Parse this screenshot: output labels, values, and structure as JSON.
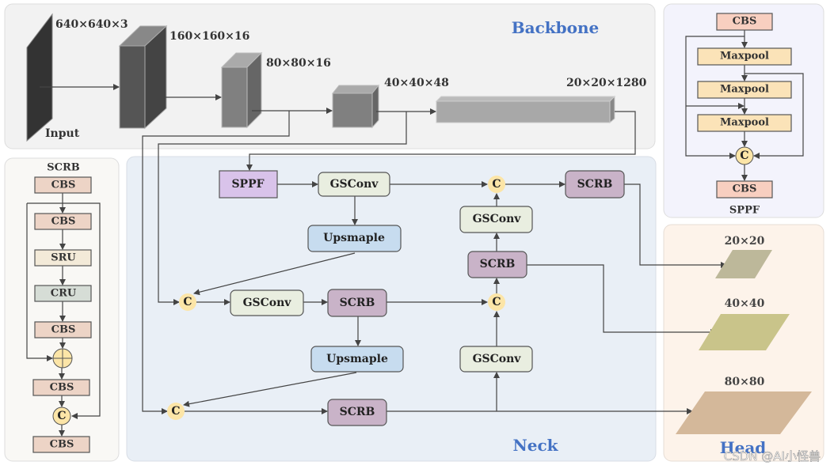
{
  "backbone": {
    "title": "Backbone",
    "input_label": "Input",
    "dims": [
      "640×640×3",
      "160×160×16",
      "80×80×16",
      "40×40×48",
      "20×20×1280"
    ]
  },
  "neck": {
    "title": "Neck",
    "sppf": "SPPF",
    "gsconv": "GSConv",
    "upsample": "Upsmaple",
    "scrb": "SCRB",
    "concat": "C"
  },
  "head": {
    "title": "Head",
    "scales": [
      "20×20",
      "40×40",
      "80×80"
    ],
    "colors": [
      "#bdb89a",
      "#c9c48a",
      "#d4b89a"
    ]
  },
  "scrb_detail": {
    "title": "SCRB",
    "cbs": "CBS",
    "sru": "SRU",
    "cru": "CRU",
    "add_symbol": "⊕",
    "concat": "C"
  },
  "sppf_detail": {
    "title": "SPPF",
    "cbs": "CBS",
    "maxpool": "Maxpool",
    "concat": "C"
  },
  "watermark": "CSDN @AI小怪兽",
  "colors": {
    "title_blue": "#4472c4",
    "scrb": "#c9b3c8",
    "gsconv": "#e9eee0",
    "upsample": "#c7dcef",
    "concat": "#fce5a7",
    "sppf": "#d9c3ea"
  }
}
